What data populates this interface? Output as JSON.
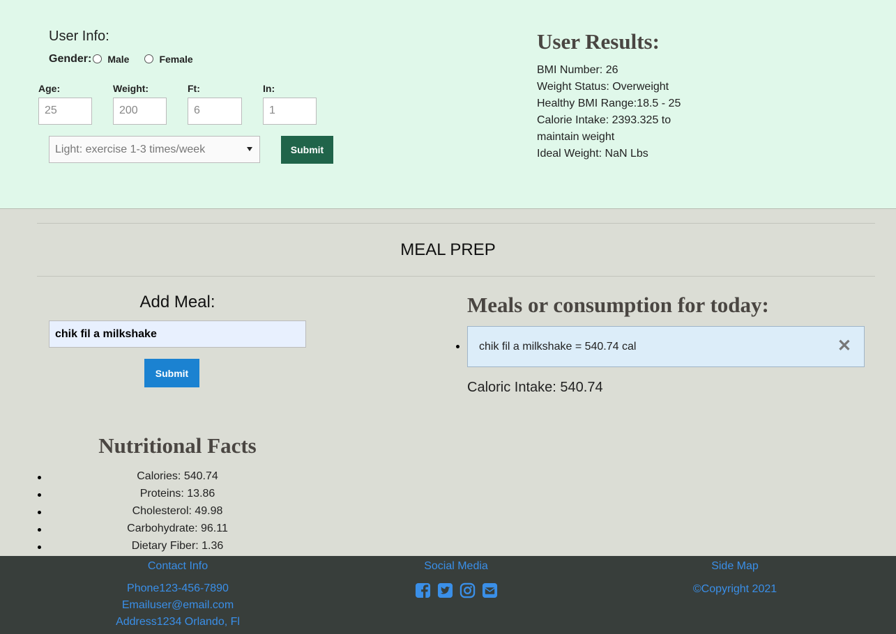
{
  "user_info": {
    "title": "User Info:",
    "gender_label": "Gender:",
    "male_label": "Male",
    "female_label": "Female",
    "fields": [
      {
        "label": "Age:",
        "placeholder": "25"
      },
      {
        "label": "Weight:",
        "placeholder": "200"
      },
      {
        "label": "Ft:",
        "placeholder": "6"
      },
      {
        "label": "In:",
        "placeholder": "1"
      }
    ],
    "activity_selected": "Light: exercise 1-3 times/week",
    "submit_label": "Submit"
  },
  "user_results": {
    "title": "User Results:",
    "lines": [
      "BMI Number: 26",
      "Weight Status: Overweight",
      "Healthy BMI Range:18.5 - 25",
      "Calorie Intake: 2393.325 to maintain weight",
      "Ideal Weight: NaN Lbs"
    ]
  },
  "meal_prep": {
    "title": "MEAL PREP",
    "add_meal_title": "Add Meal:",
    "meal_input_value": "chik fil a milkshake",
    "submit_label": "Submit",
    "meals_title": "Meals or consumption for today:",
    "meals": [
      {
        "text": "chik fil a milkshake = 540.74 cal",
        "close": "✕"
      }
    ],
    "caloric_intake": "Caloric Intake: 540.74"
  },
  "nutrition": {
    "title": "Nutritional Facts",
    "items": [
      "Calories: 540.74",
      "Proteins: 13.86",
      "Cholesterol: 49.98",
      "Carbohydrate: 96.11",
      "Dietary Fiber: 1.36"
    ]
  },
  "footer": {
    "contact": {
      "title": "Contact Info",
      "phone": "Phone123-456-7890",
      "email": "Emailuser@email.com",
      "address": "Address1234 Orlando, Fl"
    },
    "social": {
      "title": "Social Media",
      "icons": [
        "facebook-icon",
        "twitter-icon",
        "instagram-icon",
        "envelope-icon"
      ]
    },
    "sitemap": {
      "title": "Side Map",
      "copyright": "©Copyright 2021"
    }
  },
  "colors": {
    "top_bg": "#e0f8ea",
    "main_bg": "#dbddd5",
    "footer_bg": "#383e3b",
    "green_button": "#20644a",
    "blue_button": "#1b82d1",
    "link_blue": "#3a8fe8",
    "heading_serif": "#4a4642"
  }
}
